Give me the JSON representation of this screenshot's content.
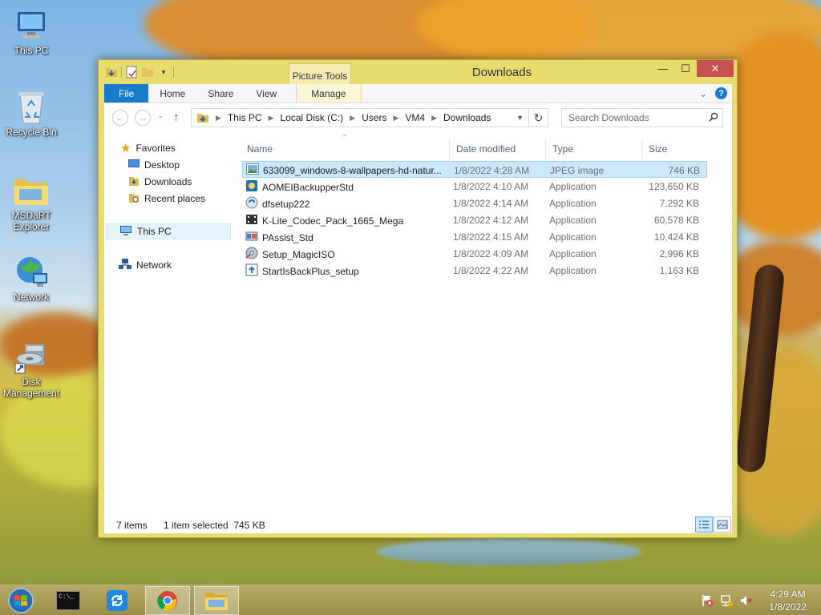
{
  "desktop": {
    "icons": [
      {
        "label": "This PC",
        "icon": "computer-icon"
      },
      {
        "label": "Recycle Bin",
        "icon": "recycle-bin-icon"
      },
      {
        "label": "MSDaRT Explorer",
        "icon": "folder-icon"
      },
      {
        "label": "Network",
        "icon": "network-globe-icon"
      },
      {
        "label": "Disk Management",
        "icon": "disk-management-icon"
      }
    ]
  },
  "window": {
    "title": "Downloads",
    "context_tab_group": "Picture Tools",
    "controls": {
      "minimize": "—",
      "maximize": "☐",
      "close": "✕"
    }
  },
  "ribbon": {
    "tabs": [
      "File",
      "Home",
      "Share",
      "View",
      "Manage"
    ],
    "collapse_glyph": "⌄",
    "help_glyph": "?"
  },
  "navigation": {
    "back_glyph": "←",
    "forward_glyph": "→",
    "recent_glyph": "⌄",
    "up_glyph": "↑",
    "refresh_glyph": "↻",
    "breadcrumb": [
      "This PC",
      "Local Disk (C:)",
      "Users",
      "VM4",
      "Downloads"
    ],
    "search_placeholder": "Search Downloads"
  },
  "nav_pane": {
    "favorites_label": "Favorites",
    "favorites": [
      "Desktop",
      "Downloads",
      "Recent places"
    ],
    "this_pc_label": "This PC",
    "network_label": "Network"
  },
  "file_list": {
    "columns": {
      "name": "Name",
      "date": "Date modified",
      "type": "Type",
      "size": "Size"
    },
    "sort_indicator": "⌃",
    "rows": [
      {
        "name": "633099_windows-8-wallpapers-hd-natur...",
        "date": "1/8/2022 4:28 AM",
        "type": "JPEG image",
        "size": "746 KB",
        "icon": "image-file-icon"
      },
      {
        "name": "AOMEIBackupperStd",
        "date": "1/8/2022 4:10 AM",
        "type": "Application",
        "size": "123,650 KB",
        "icon": "backup-app-icon"
      },
      {
        "name": "dfsetup222",
        "date": "1/8/2022 4:14 AM",
        "type": "Application",
        "size": "7,292 KB",
        "icon": "setup-app-icon"
      },
      {
        "name": "K-Lite_Codec_Pack_1665_Mega",
        "date": "1/8/2022 4:12 AM",
        "type": "Application",
        "size": "60,578 KB",
        "icon": "codec-app-icon"
      },
      {
        "name": "PAssist_Std",
        "date": "1/8/2022 4:15 AM",
        "type": "Application",
        "size": "10,424 KB",
        "icon": "partition-app-icon"
      },
      {
        "name": "Setup_MagicISO",
        "date": "1/8/2022 4:09 AM",
        "type": "Application",
        "size": "2,996 KB",
        "icon": "disc-app-icon"
      },
      {
        "name": "StartIsBackPlus_setup",
        "date": "1/8/2022 4:22 AM",
        "type": "Application",
        "size": "1,163 KB",
        "icon": "installer-app-icon"
      }
    ]
  },
  "status_bar": {
    "item_count": "7 items",
    "selection": "1 item selected  745 KB"
  },
  "taskbar": {
    "time": "4:29 AM",
    "date": "1/8/2022",
    "cmd_prompt_text": "C:\\_"
  }
}
